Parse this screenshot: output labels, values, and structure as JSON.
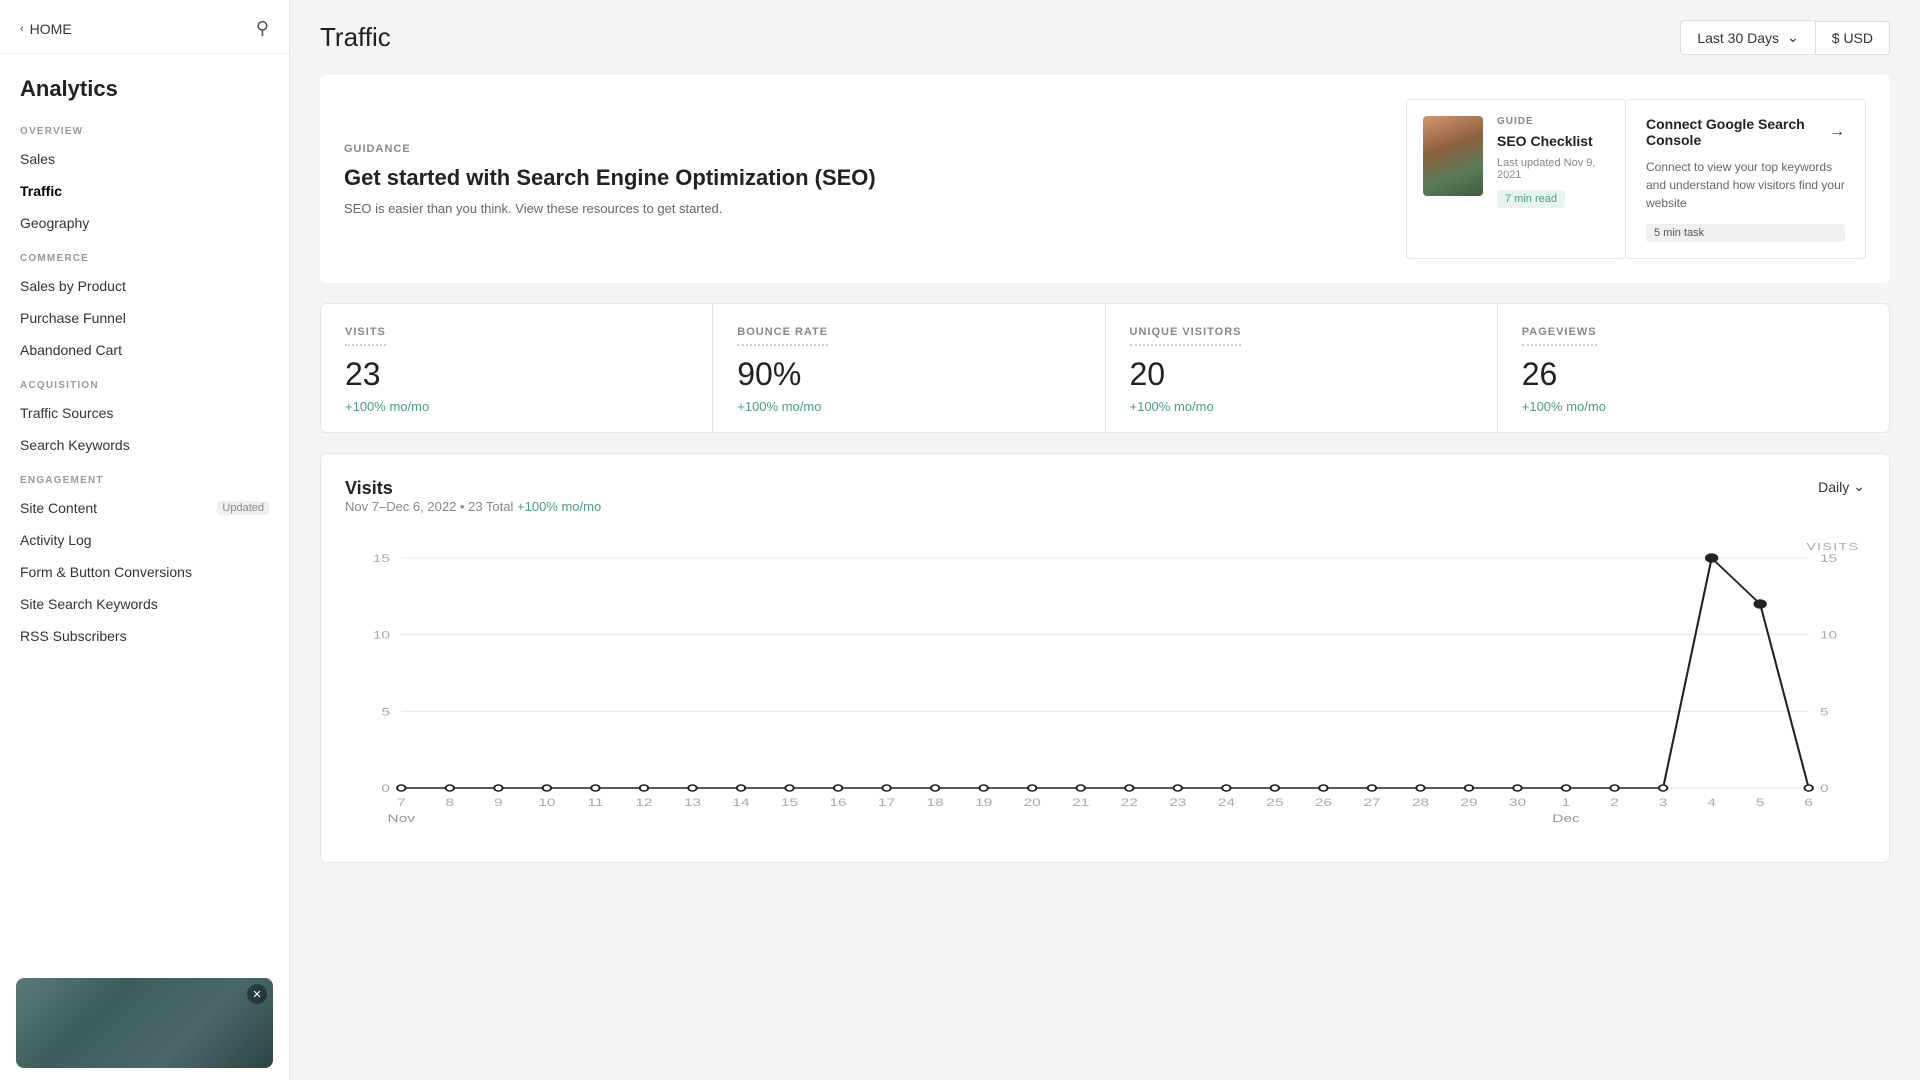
{
  "sidebar": {
    "home_label": "HOME",
    "analytics_title": "Analytics",
    "search_placeholder": "Search",
    "sections": [
      {
        "label": "OVERVIEW",
        "items": [
          {
            "id": "sales",
            "label": "Sales",
            "badge": "",
            "active": false
          },
          {
            "id": "traffic",
            "label": "Traffic",
            "badge": "",
            "active": true
          },
          {
            "id": "geography",
            "label": "Geography",
            "badge": "",
            "active": false
          }
        ]
      },
      {
        "label": "COMMERCE",
        "items": [
          {
            "id": "sales-by-product",
            "label": "Sales by Product",
            "badge": "",
            "active": false
          },
          {
            "id": "purchase-funnel",
            "label": "Purchase Funnel",
            "badge": "",
            "active": false
          },
          {
            "id": "abandoned-cart",
            "label": "Abandoned Cart",
            "badge": "",
            "active": false
          }
        ]
      },
      {
        "label": "ACQUISITION",
        "items": [
          {
            "id": "traffic-sources",
            "label": "Traffic Sources",
            "badge": "",
            "active": false
          },
          {
            "id": "search-keywords",
            "label": "Search Keywords",
            "badge": "",
            "active": false
          }
        ]
      },
      {
        "label": "ENGAGEMENT",
        "items": [
          {
            "id": "site-content",
            "label": "Site Content",
            "badge": "Updated",
            "active": false
          },
          {
            "id": "activity-log",
            "label": "Activity Log",
            "badge": "",
            "active": false
          },
          {
            "id": "form-conversions",
            "label": "Form & Button Conversions",
            "badge": "",
            "active": false
          },
          {
            "id": "site-search-keywords",
            "label": "Site Search Keywords",
            "badge": "",
            "active": false
          },
          {
            "id": "rss-subscribers",
            "label": "RSS Subscribers",
            "badge": "",
            "active": false
          }
        ]
      }
    ]
  },
  "header": {
    "title": "Traffic",
    "date_range": "Last 30 Days",
    "currency": "$ USD"
  },
  "guidance": {
    "tag": "GUIDANCE",
    "heading": "Get started with Search Engine Optimization (SEO)",
    "description": "SEO is easier than you think. View these resources to get started.",
    "guide": {
      "tag": "GUIDE",
      "title": "SEO Checklist",
      "date": "Last updated Nov 9, 2021",
      "badge": "7 min read"
    },
    "connect": {
      "title": "Connect Google Search Console",
      "description": "Connect to view your top keywords and understand how visitors find your website",
      "badge": "5 min task"
    }
  },
  "stats": [
    {
      "label": "VISITS",
      "value": "23",
      "change": "+100% mo/mo"
    },
    {
      "label": "BOUNCE RATE",
      "value": "90%",
      "change": "+100% mo/mo"
    },
    {
      "label": "UNIQUE VISITORS",
      "value": "20",
      "change": "+100% mo/mo"
    },
    {
      "label": "PAGEVIEWS",
      "value": "26",
      "change": "+100% mo/mo"
    }
  ],
  "chart": {
    "title": "Visits",
    "subtitle_date": "Nov 7–Dec 6, 2022",
    "subtitle_total": "23 Total",
    "change": "+100% mo/mo",
    "frequency": "Daily",
    "y_labels": [
      "0",
      "5",
      "10",
      "15"
    ],
    "x_labels": [
      "7",
      "8",
      "9",
      "10",
      "11",
      "12",
      "13",
      "14",
      "15",
      "16",
      "17",
      "18",
      "19",
      "20",
      "21",
      "22",
      "23",
      "24",
      "25",
      "26",
      "27",
      "28",
      "29",
      "30",
      "1",
      "2",
      "3",
      "4",
      "5",
      "6"
    ],
    "x_month_labels": [
      {
        "label": "Nov",
        "index": 0
      },
      {
        "label": "Dec",
        "index": 24
      }
    ],
    "data_points": [
      0,
      0,
      0,
      0,
      0,
      0,
      0,
      0,
      0,
      0,
      0,
      0,
      0,
      0,
      0,
      0,
      0,
      0,
      0,
      0,
      0,
      0,
      0,
      0,
      0,
      0,
      0,
      15,
      12,
      0
    ]
  },
  "colors": {
    "accent_green": "#4a9e85",
    "chart_line": "#222222",
    "badge_green_bg": "#e8f4f0",
    "badge_green_text": "#4a9e85"
  }
}
